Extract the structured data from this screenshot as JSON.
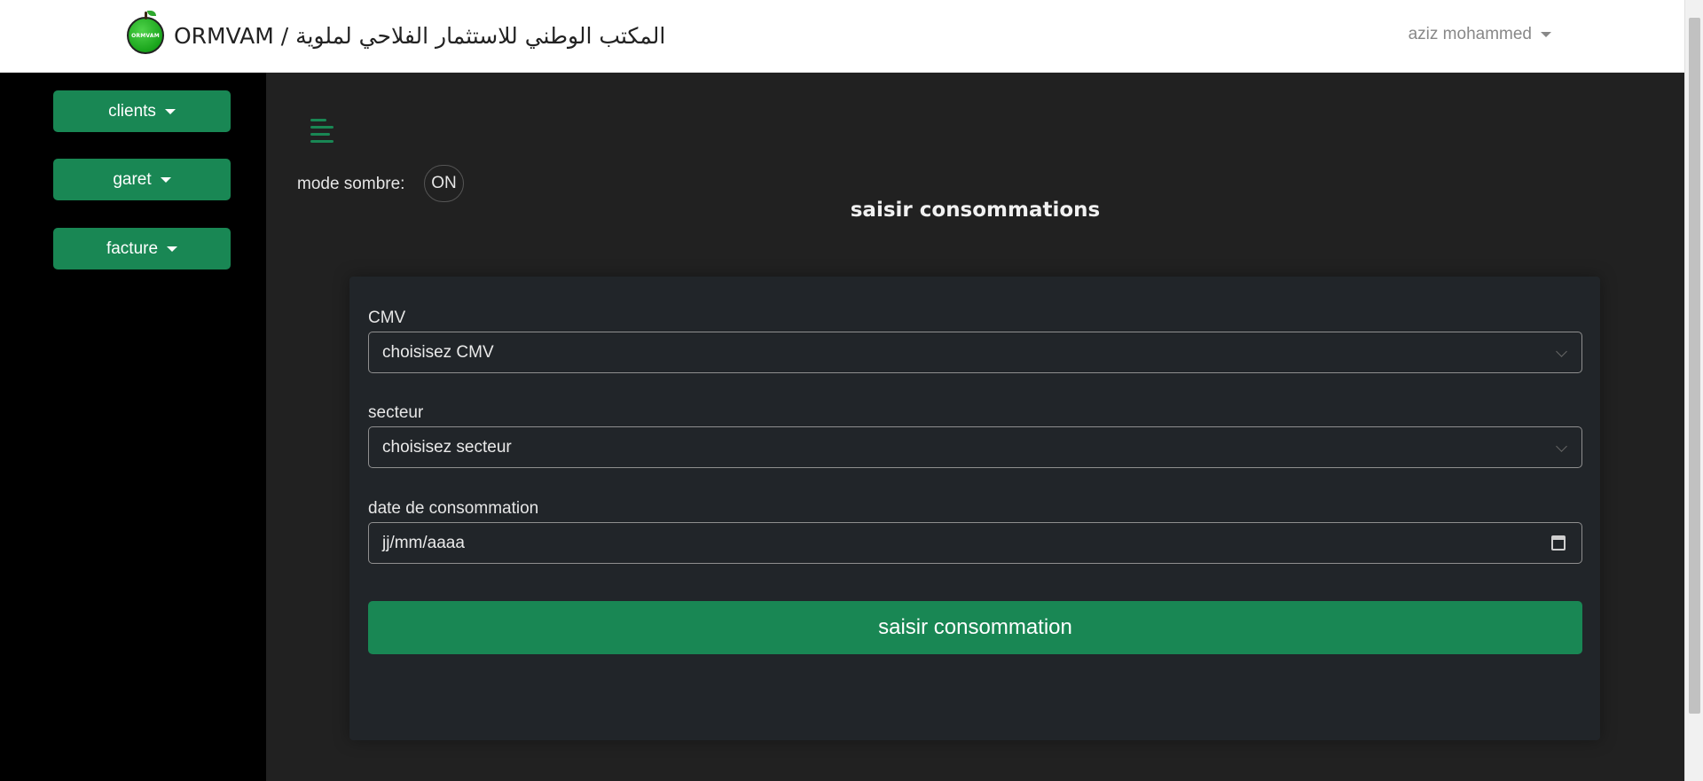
{
  "navbar": {
    "logo_text": "ORMVAM",
    "brand": "ORMVAM / المكتب الوطني للاستثمار الفلاحي لملوية",
    "user": "aziz mohammed"
  },
  "sidebar": {
    "items": [
      {
        "label": "clients"
      },
      {
        "label": "garet"
      },
      {
        "label": "facture"
      }
    ]
  },
  "main": {
    "dark_mode_label": "mode sombre:",
    "dark_mode_state": "ON",
    "title": "saisir consommations",
    "form": {
      "cmv_label": "CMV",
      "cmv_value": "choisisez CMV",
      "secteur_label": "secteur",
      "secteur_value": "choisisez secteur",
      "date_label": "date de consommation",
      "date_placeholder": "jj/mm/aaaa",
      "submit_label": "saisir consommation"
    }
  },
  "colors": {
    "accent": "#198754",
    "sidebar_bg": "#000000",
    "main_bg": "#212121",
    "card_bg": "#212529"
  }
}
